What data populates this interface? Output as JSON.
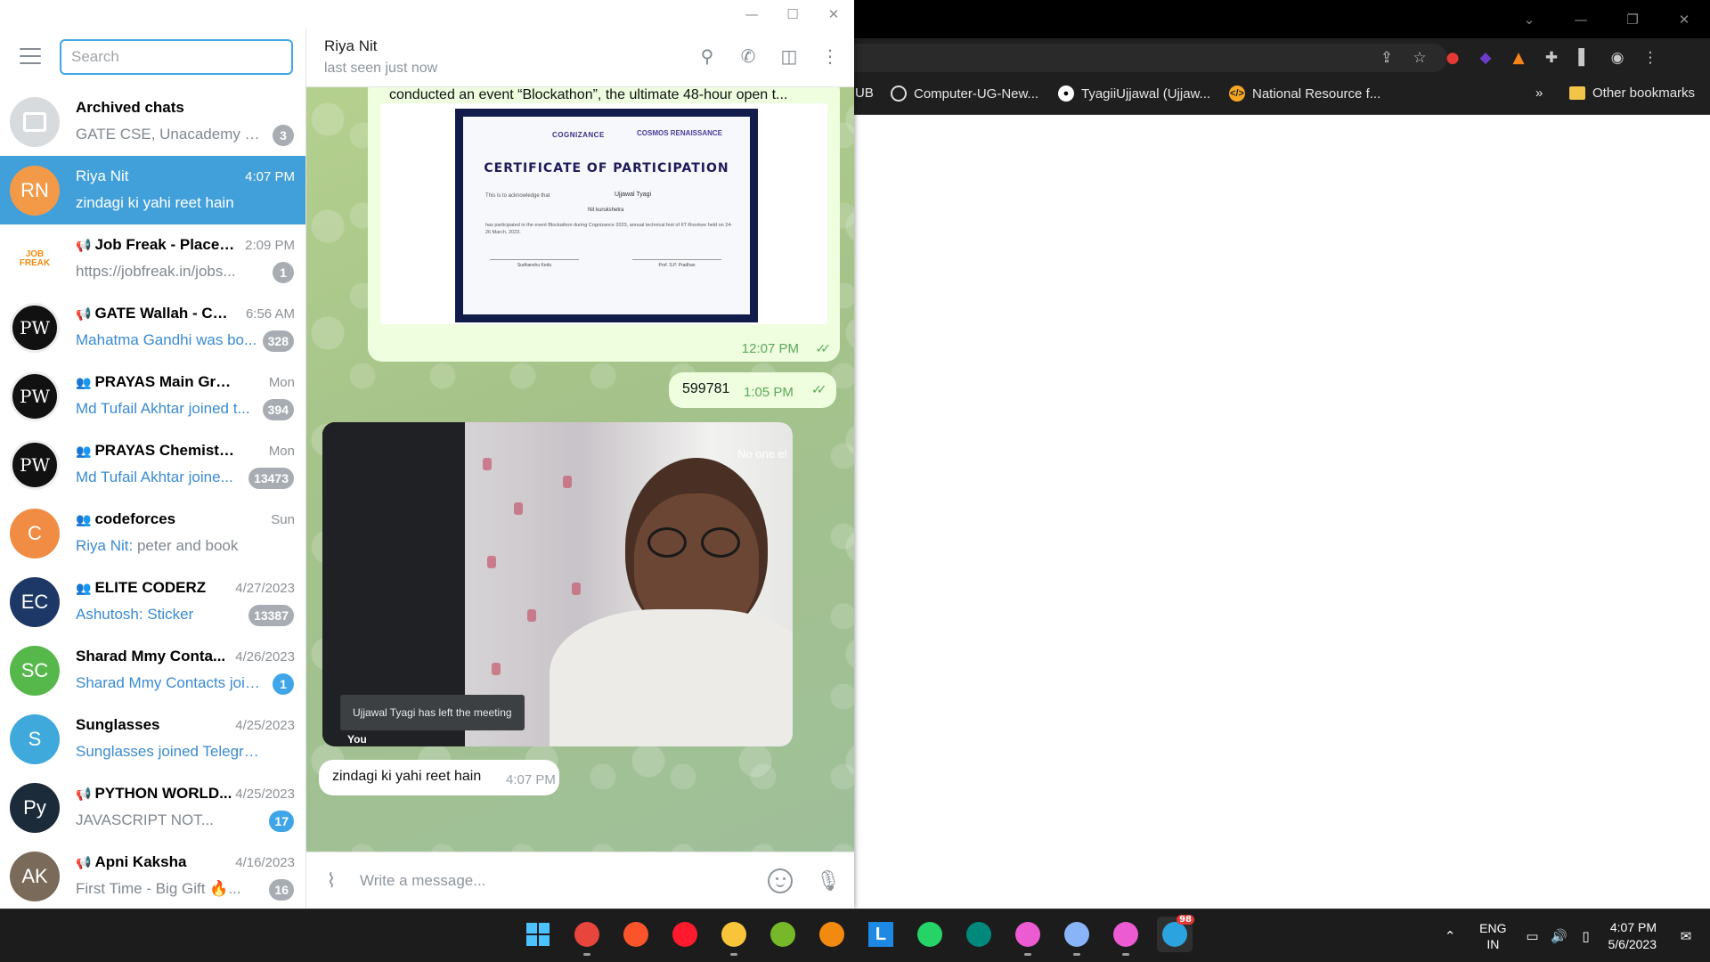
{
  "browser": {
    "bookmarks": [
      {
        "label": "UB",
        "icon": "bookmark-fragment"
      },
      {
        "label": "Computer-UG-New...",
        "icon": "globe-icon"
      },
      {
        "label": "TyagiiUjjawal (Ujjaw...",
        "icon": "github-icon"
      },
      {
        "label": "National Resource f...",
        "icon": "code-icon"
      },
      {
        "label": "»",
        "icon": "overflow-icon"
      },
      {
        "label": "Other bookmarks",
        "icon": "folder-icon"
      }
    ]
  },
  "telegram": {
    "search_placeholder": "Search",
    "chats": [
      {
        "name": "Archived chats",
        "time": "",
        "preview": "GATE CSE, Unacademy GA...",
        "badge": "3",
        "avatar_text": "",
        "avatar_color": "#d8dbde",
        "type": "archive"
      },
      {
        "name": "Riya Nit",
        "time": "4:07 PM",
        "preview": "zindagi ki yahi reet hain",
        "badge": "",
        "avatar_text": "RN",
        "avatar_color": "#f39a49",
        "active": true
      },
      {
        "name": "Job Freak - Placem...",
        "time": "2:09 PM",
        "preview": "https://jobfreak.in/jobs...",
        "badge": "1",
        "avatar_text": "JOB FREAK",
        "avatar_color": "#ffffff",
        "type": "channel"
      },
      {
        "name": "GATE Wallah - Com...",
        "time": "6:56 AM",
        "preview": "Mahatma Gandhi was bo...",
        "badge": "328",
        "avatar_text": "PW",
        "avatar_color": "#111111",
        "type": "channel"
      },
      {
        "name": "PRAYAS Main Group",
        "time": "Mon",
        "preview": "Md Tufail Akhtar joined t...",
        "badge": "394",
        "avatar_text": "PW",
        "avatar_color": "#111111",
        "type": "group"
      },
      {
        "name": "PRAYAS Chemistry Do...",
        "time": "Mon",
        "preview": "Md Tufail Akhtar joine...",
        "badge": "13473",
        "avatar_text": "PW",
        "avatar_color": "#111111",
        "type": "group"
      },
      {
        "name": "codeforces",
        "time": "Sun",
        "preview": "peter and book",
        "sender": "Riya Nit: ",
        "badge": "",
        "avatar_text": "C",
        "avatar_color": "#f08c44",
        "type": "group"
      },
      {
        "name": "ELITE CODERZ",
        "time": "4/27/2023",
        "preview": "Sticker",
        "sender": "Ashutosh: ",
        "badge": "13387",
        "avatar_text": "EC",
        "avatar_color": "#1d3766",
        "type": "group"
      },
      {
        "name": "Sharad Mmy Conta...",
        "time": "4/26/2023",
        "preview": "Sharad Mmy Contacts join...",
        "badge": "1",
        "badge_blue": true,
        "avatar_text": "SC",
        "avatar_color": "#56b84a"
      },
      {
        "name": "Sunglasses",
        "time": "4/25/2023",
        "preview": "Sunglasses joined Telegram",
        "badge": "",
        "avatar_text": "S",
        "avatar_color": "#3fa9dc"
      },
      {
        "name": "PYTHON WORLD...",
        "time": "4/25/2023",
        "preview": "JAVASCRIPT NOT...",
        "badge": "17",
        "badge_blue": true,
        "avatar_text": "Py",
        "avatar_color": "#1b2b3a",
        "type": "channel"
      },
      {
        "name": "Apni Kaksha",
        "time": "4/16/2023",
        "preview": "First Time - Big Gift 🔥...",
        "badge": "16",
        "avatar_text": "AK",
        "avatar_color": "#7a6a5a",
        "type": "channel"
      }
    ],
    "conversation": {
      "peer_name": "Riya Nit",
      "peer_status": "last seen just now",
      "image_caption": "conducted an event “Blockathon”, the ultimate 48-hour open t...",
      "certificate": {
        "org": "COGNIZANCE",
        "org2": "COSMOS RENAISSANCE",
        "title": "CERTIFICATE OF PARTICIPATION",
        "ack": "This is to acknowledge that",
        "person": "Ujjawal Tyagi",
        "institute": "Nit kurukshetra",
        "body": "has participated in the event Blockathon during Cognizance 2023, annual technical fest of IIT Roorkee held on 24-26 March, 2023.",
        "sig_left": "Sudhanshu Kedu",
        "sig_right": "Prof. S.P. Pradhan"
      },
      "image_time": "12:07 PM",
      "number_message": "599781",
      "number_time": "1:05 PM",
      "meet": {
        "notice": "Ujjawal Tyagi has left the meeting",
        "you_label": "You",
        "no_one": "No one el"
      },
      "last_message": "zindagi ki yahi reet hain",
      "last_time": "4:07 PM",
      "composer_placeholder": "Write a message..."
    }
  },
  "taskbar": {
    "apps": [
      {
        "name": "start-icon",
        "color": "#4cc2ff"
      },
      {
        "name": "chrome-icon",
        "color": "#e8453c",
        "running": true
      },
      {
        "name": "brave-icon",
        "color": "#fb542b"
      },
      {
        "name": "opera-icon",
        "color": "#ff1b2d"
      },
      {
        "name": "file-explorer-icon",
        "color": "#f8c53a",
        "running": true
      },
      {
        "name": "utorrent-icon",
        "color": "#76b82a"
      },
      {
        "name": "vlc-icon",
        "color": "#f28a0f"
      },
      {
        "name": "l-app-icon",
        "color": "#1e88e5",
        "label": "L"
      },
      {
        "name": "whatsapp-icon",
        "color": "#25d366"
      },
      {
        "name": "meet-icon",
        "color": "#00897b"
      },
      {
        "name": "pink-app-icon",
        "color": "#ec5bd2",
        "running": true
      },
      {
        "name": "settings-icon",
        "color": "#8ab4f8",
        "running": true
      },
      {
        "name": "pink-app-2-icon",
        "color": "#ec5bd2",
        "running": true
      },
      {
        "name": "telegram-icon",
        "color": "#2aa3de",
        "focused": true,
        "badge": "98"
      }
    ],
    "lang_top": "ENG",
    "lang_bottom": "IN",
    "time": "4:07 PM",
    "date": "5/6/2023"
  }
}
